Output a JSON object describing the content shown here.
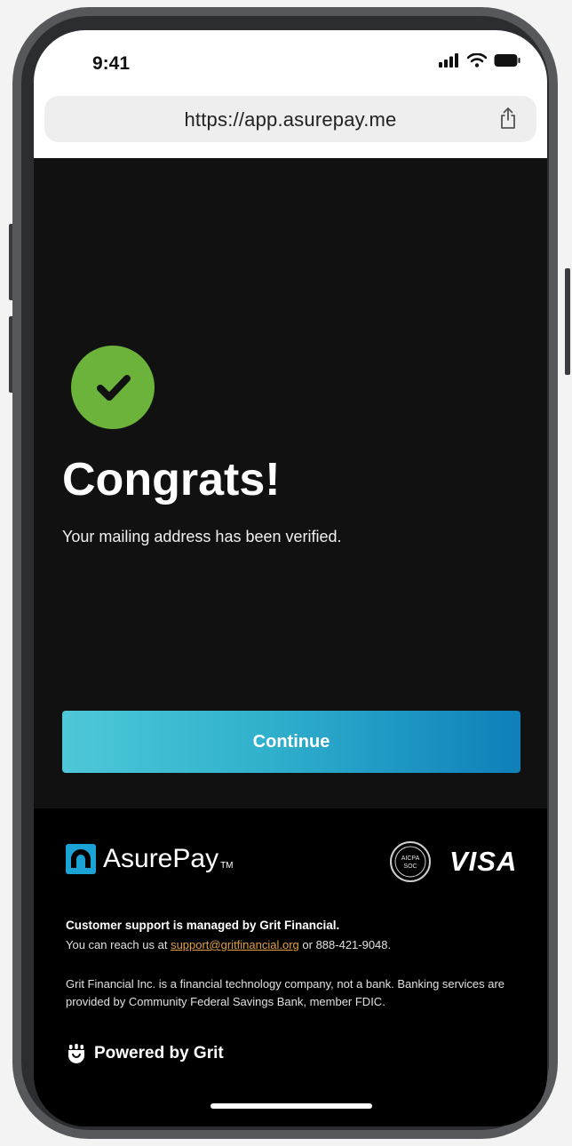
{
  "status_bar": {
    "time": "9:41"
  },
  "browser": {
    "url": "https://app.asurepay.me"
  },
  "main": {
    "title": "Congrats!",
    "subtitle": "Your mailing address has been verified.",
    "continue_label": "Continue"
  },
  "footer": {
    "brand_name": "AsurePay",
    "brand_tm": "TM",
    "soc_badge": {
      "line1": "AICPA",
      "line2": "SOC"
    },
    "visa_label": "VISA",
    "support_title": "Customer support is managed by Grit Financial.",
    "support_prefix": "You can reach us at ",
    "support_email": "support@gritfinancial.org",
    "support_suffix": " or 888-421-9048.",
    "disclaimer": "Grit Financial Inc. is a financial technology company, not a bank. Banking services are provided by Community Federal Savings Bank, member FDIC.",
    "powered_by": "Powered by Grit"
  },
  "colors": {
    "check_green": "#6bb33a",
    "button_gradient_start": "#4ec8d8",
    "button_gradient_end": "#0e7fba",
    "brand_blue": "#1ca3d6",
    "link_orange": "#e0a040",
    "screen_bg": "#111112"
  },
  "icons": [
    "signal-icon",
    "wifi-icon",
    "battery-icon",
    "share-icon",
    "checkmark-icon",
    "asurepay-logo-icon",
    "soc-badge-icon",
    "grit-logo-icon"
  ]
}
